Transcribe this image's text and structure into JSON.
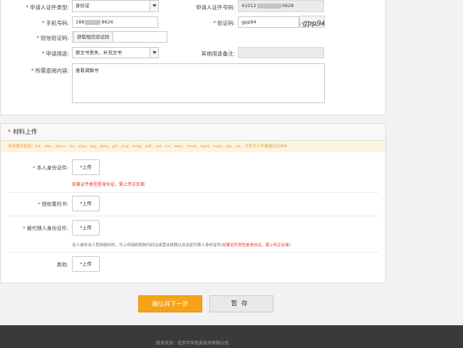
{
  "form": {
    "id_type": {
      "label": "申请人证件类型:",
      "value": "身份证"
    },
    "id_number": {
      "label": "申请人证件号码:",
      "prefix": "41012",
      "suffix": "0628"
    },
    "phone": {
      "label": "手机号码:",
      "prefix": "188",
      "suffix": "8626"
    },
    "captcha": {
      "label": "验证码:",
      "value": "gpp94",
      "image_text": "gpp94"
    },
    "sms_code": {
      "label": "短信验证码:",
      "button": "获取短信验证码"
    },
    "purpose": {
      "label": "申请用途:",
      "value": "原文书丢失、补充文书"
    },
    "other_purpose": {
      "label": "其他用途备注:",
      "value": ""
    },
    "content": {
      "label": "所需查阅内容:",
      "value": "查看调解书"
    }
  },
  "materials": {
    "title": "材料上传",
    "formats": "支持格式包括：txt、doc、docx、xls、xlsx、jpg、jpeg、gif、png、bmp、pdf、avi、rm、wav、rmvb、mp3、mp4、zip、rar，文件大小不能超过20MB",
    "upload_label": "*上传",
    "rows": [
      {
        "label": "本人身份证件:",
        "warning": "如果证件类型是身份证，需上传正反面"
      },
      {
        "label": "授权委托书:"
      },
      {
        "label": "被代理人身份证件:",
        "note": "法人或非法人其他组织的，可上传组织机构代码证或营业执照以及法定代表人身份证件",
        "note_red": "(如果证件类型是身份证，需上传正反面)"
      },
      {
        "label": "其他:"
      }
    ]
  },
  "actions": {
    "confirm": "确认并下一步",
    "save": "暂存"
  },
  "footer": {
    "text": "技术支持：北京华宇信息技术有限公司"
  }
}
